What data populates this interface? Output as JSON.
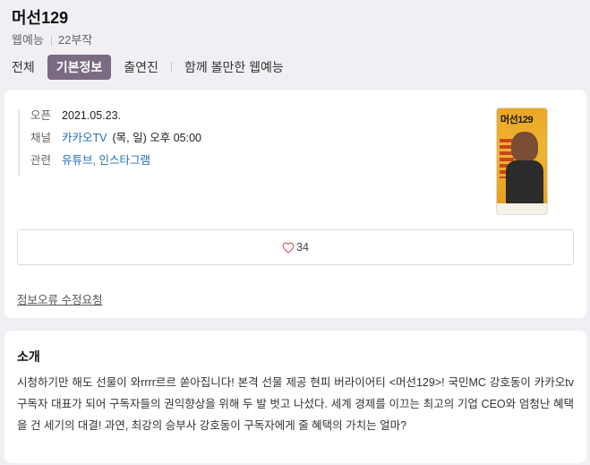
{
  "header": {
    "title": "머선129",
    "genre": "웹예능",
    "episodes": "22부작"
  },
  "tabs": [
    {
      "label": "전체"
    },
    {
      "label": "기본정보",
      "active": true
    },
    {
      "label": "출연진"
    },
    {
      "label": "함께 볼만한 웹예능"
    }
  ],
  "info": {
    "open_label": "오픈",
    "open_value": "2021.05.23.",
    "channel_label": "채널",
    "channel_link": "카카오TV",
    "channel_schedule": "(목, 일) 오후 05:00",
    "related_label": "관련",
    "related_links": [
      "유튜브",
      "인스타그램"
    ],
    "related_sep": ","
  },
  "poster": {
    "title_text": "머선129",
    "icon": "poster-image"
  },
  "like": {
    "count": "34",
    "icon": "heart-icon"
  },
  "report_link": "정보오류 수정요청",
  "intro": {
    "title": "소개",
    "body": "시청하기만 해도 선물이 와rrrr르르 쏟아집니다! 본격 선물 제공 현피 버라이어티 <머선129>! 국민MC 강호동이 카카오tv 구독자 대표가 되어 구독자들의 권익향상을 위해 두 발 벗고 나섰다. 세계 경제를 이끄는 최고의 기업 CEO와 엄청난 혜택을 건 세기의 대결! 과연, 최강의 승부사 강호동이 구독자에게 줄 혜택의 가치는 얼마?"
  },
  "colors": {
    "background": "#f1eff3",
    "active_tab": "#7a6a82",
    "link": "#1f6fb8"
  }
}
